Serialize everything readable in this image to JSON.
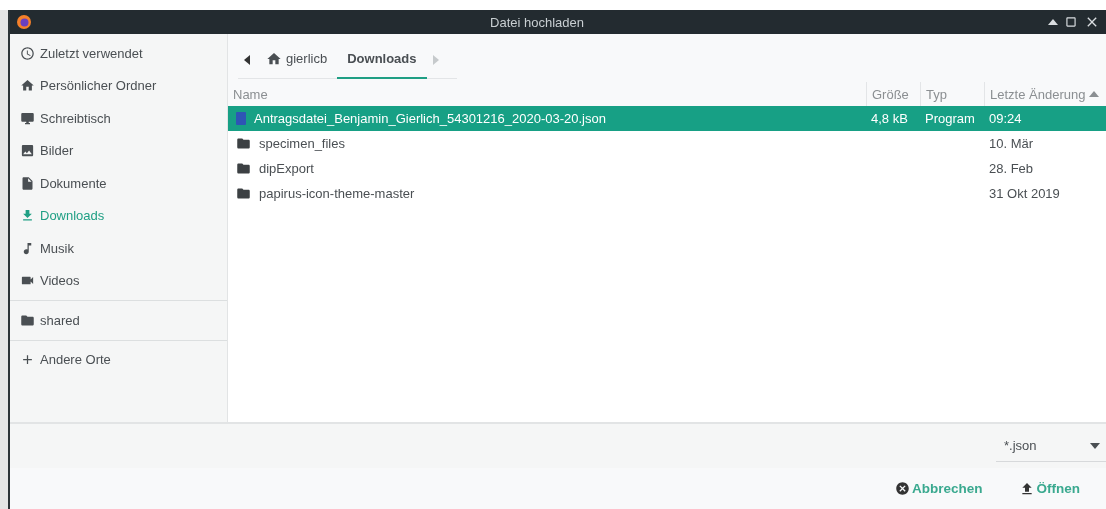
{
  "window": {
    "title": "Datei hochladen"
  },
  "sidebar": {
    "sections": [
      [
        {
          "label": "Zuletzt verwendet",
          "selected": false
        },
        {
          "label": "Persönlicher Ordner",
          "selected": false
        },
        {
          "label": "Schreibtisch",
          "selected": false
        },
        {
          "label": "Bilder",
          "selected": false
        },
        {
          "label": "Dokumente",
          "selected": false
        },
        {
          "label": "Downloads",
          "selected": true
        },
        {
          "label": "Musik",
          "selected": false
        },
        {
          "label": "Videos",
          "selected": false
        }
      ],
      [
        {
          "label": "shared",
          "selected": false
        }
      ],
      [
        {
          "label": "Andere Orte",
          "selected": false
        }
      ]
    ]
  },
  "path": [
    {
      "label": "gierlicb",
      "selected": false
    },
    {
      "label": "Downloads",
      "selected": true
    }
  ],
  "table": {
    "columns": [
      {
        "label": "Name",
        "sorted": false
      },
      {
        "label": "Größe",
        "sorted": false
      },
      {
        "label": "Typ",
        "sorted": false
      },
      {
        "label": "Letzte Änderung",
        "sorted": true
      }
    ],
    "rows": [
      {
        "kind": "json",
        "name": "Antragsdatei_Benjamin_Gierlich_54301216_2020-03-20.json",
        "size": "4,8 kB",
        "type": "Program",
        "modified": "09:24",
        "selected": true
      },
      {
        "kind": "folder",
        "name": "specimen_files",
        "modified": "10. Mär",
        "selected": false
      },
      {
        "kind": "folder",
        "name": "dipExport",
        "modified": "28. Feb",
        "selected": false
      },
      {
        "kind": "folder",
        "name": "papirus-icon-theme-master",
        "modified": "31 Okt 2019",
        "selected": false
      }
    ]
  },
  "filter": {
    "value": "*.json"
  },
  "buttons": [
    {
      "label": "Abbrechen",
      "kind": "cancel"
    },
    {
      "label": "Öffnen",
      "kind": "open"
    }
  ]
}
